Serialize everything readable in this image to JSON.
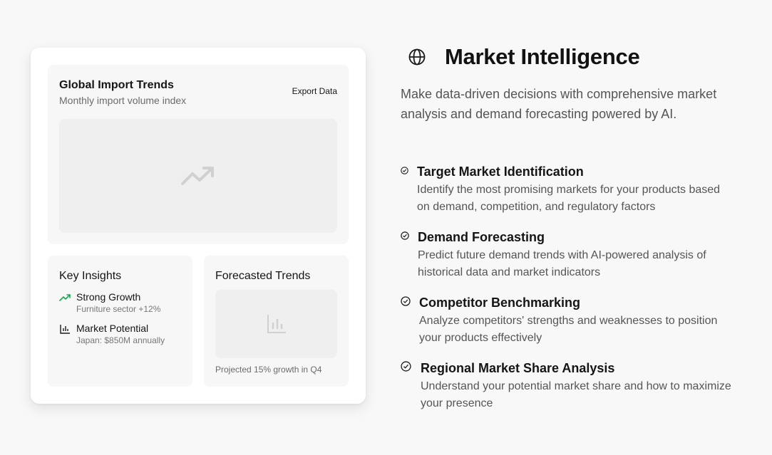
{
  "card": {
    "main": {
      "title": "Global Import Trends",
      "subtitle": "Monthly import volume index",
      "export_label": "Export Data",
      "chart_icon": "trending-up-icon"
    },
    "insights": {
      "title": "Key Insights",
      "items": [
        {
          "title": "Strong Growth",
          "detail": "Furniture sector +12%",
          "icon": "trending-up-icon",
          "color": "#22a559"
        },
        {
          "title": "Market Potential",
          "detail": "Japan: $850M annually",
          "icon": "bar-chart-icon",
          "color": "#1a1a1a"
        }
      ]
    },
    "forecast": {
      "title": "Forecasted Trends",
      "icon": "bar-chart-icon",
      "note": "Projected 15% growth in Q4"
    }
  },
  "section": {
    "icon": "globe-icon",
    "title": "Market Intelligence",
    "intro": "Make data-driven decisions with comprehensive market analysis and demand forecasting powered by AI.",
    "features": [
      {
        "title": "Target Market Identification",
        "desc": "Identify the most promising markets for your products based on demand, competition, and regulatory factors"
      },
      {
        "title": "Demand Forecasting",
        "desc": "Predict future demand trends with AI-powered analysis of historical data and market indicators"
      },
      {
        "title": "Competitor Benchmarking",
        "desc": "Analyze competitors' strengths and weaknesses to position your products effectively"
      },
      {
        "title": "Regional Market Share Analysis",
        "desc": "Understand your potential market share and how to maximize your presence"
      }
    ]
  }
}
